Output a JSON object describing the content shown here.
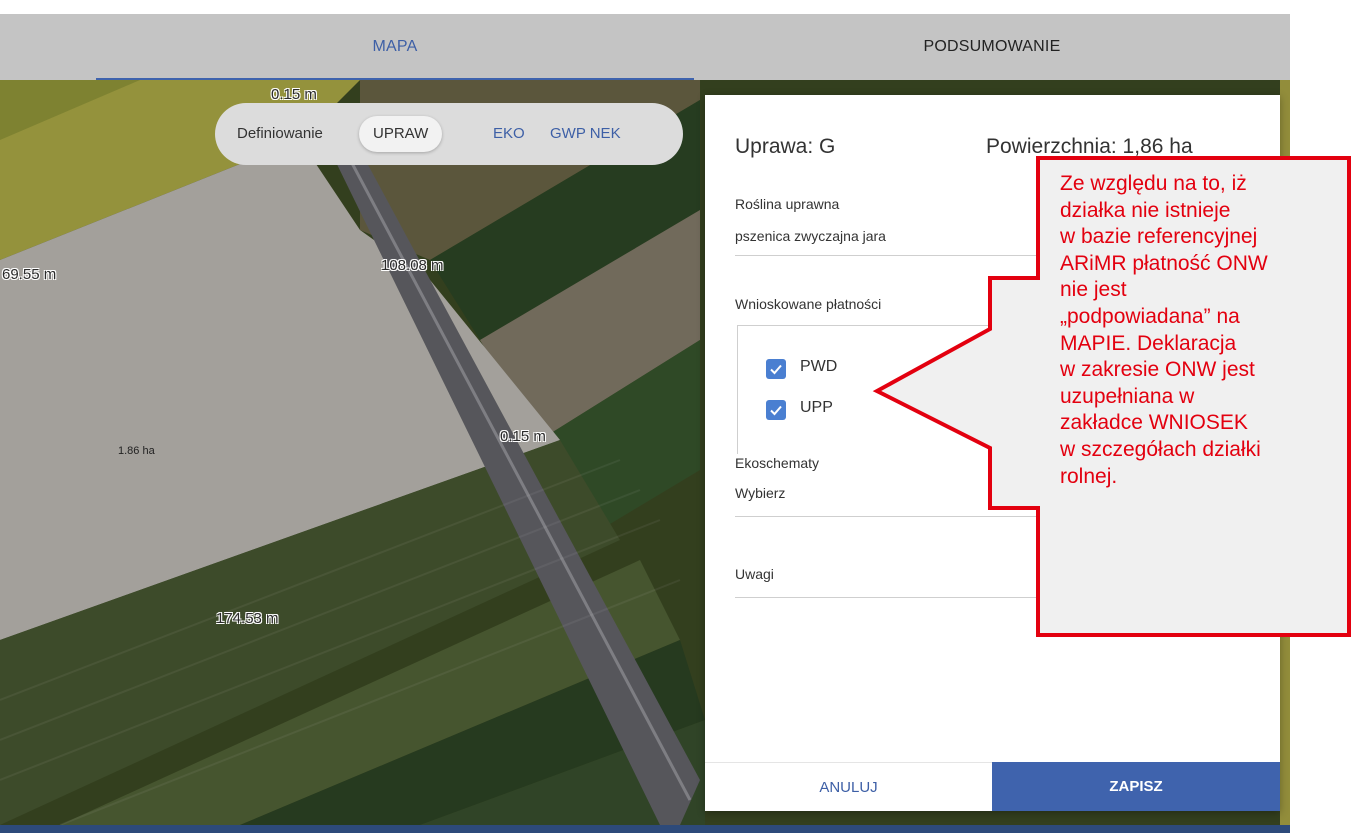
{
  "tabs": {
    "mapa": "MAPA",
    "podsumowanie": "PODSUMOWANIE"
  },
  "definiowanie": {
    "label": "Definiowanie",
    "options": [
      "UPRAW",
      "EKO",
      "GWP NEK"
    ],
    "selected": "UPRAW"
  },
  "map": {
    "measurements": [
      "0.15 m",
      "69.55 m",
      "108.08 m",
      "0.15 m",
      "174.53 m"
    ],
    "area_label": "1.86  ha"
  },
  "panel": {
    "title": "Uprawa: G",
    "area": "Powierzchnia: 1,86 ha",
    "crop_label": "Roślina uprawna",
    "crop_value": "pszenica zwyczajna jara",
    "payments_label": "Wnioskowane płatności",
    "payments": [
      {
        "label": "PWD",
        "checked": true
      },
      {
        "label": "UPP",
        "checked": true
      }
    ],
    "ekoschematy_label": "Ekoschematy",
    "ekoschematy_value": "Wybierz",
    "uwagi_placeholder": "Uwagi",
    "cancel_label": "ANULUJ",
    "save_label": "ZAPISZ"
  },
  "callout": {
    "lines": [
      "Ze względu na to, iż",
      "działka nie istnieje",
      "w bazie referencyjnej",
      "ARiMR płatność ONW",
      "nie jest",
      "„podpowiadana” na",
      "MAPIE. Deklaracja",
      "w zakresie ONW jest",
      "uzupełniana w",
      "zakładce WNIOSEK",
      "w szczegółach działki",
      "rolnej."
    ],
    "border_color": "#e3000f",
    "text_color": "#e3000f"
  },
  "colors": {
    "accent": "#3f63ad",
    "checkbox": "#4a7fd1"
  }
}
